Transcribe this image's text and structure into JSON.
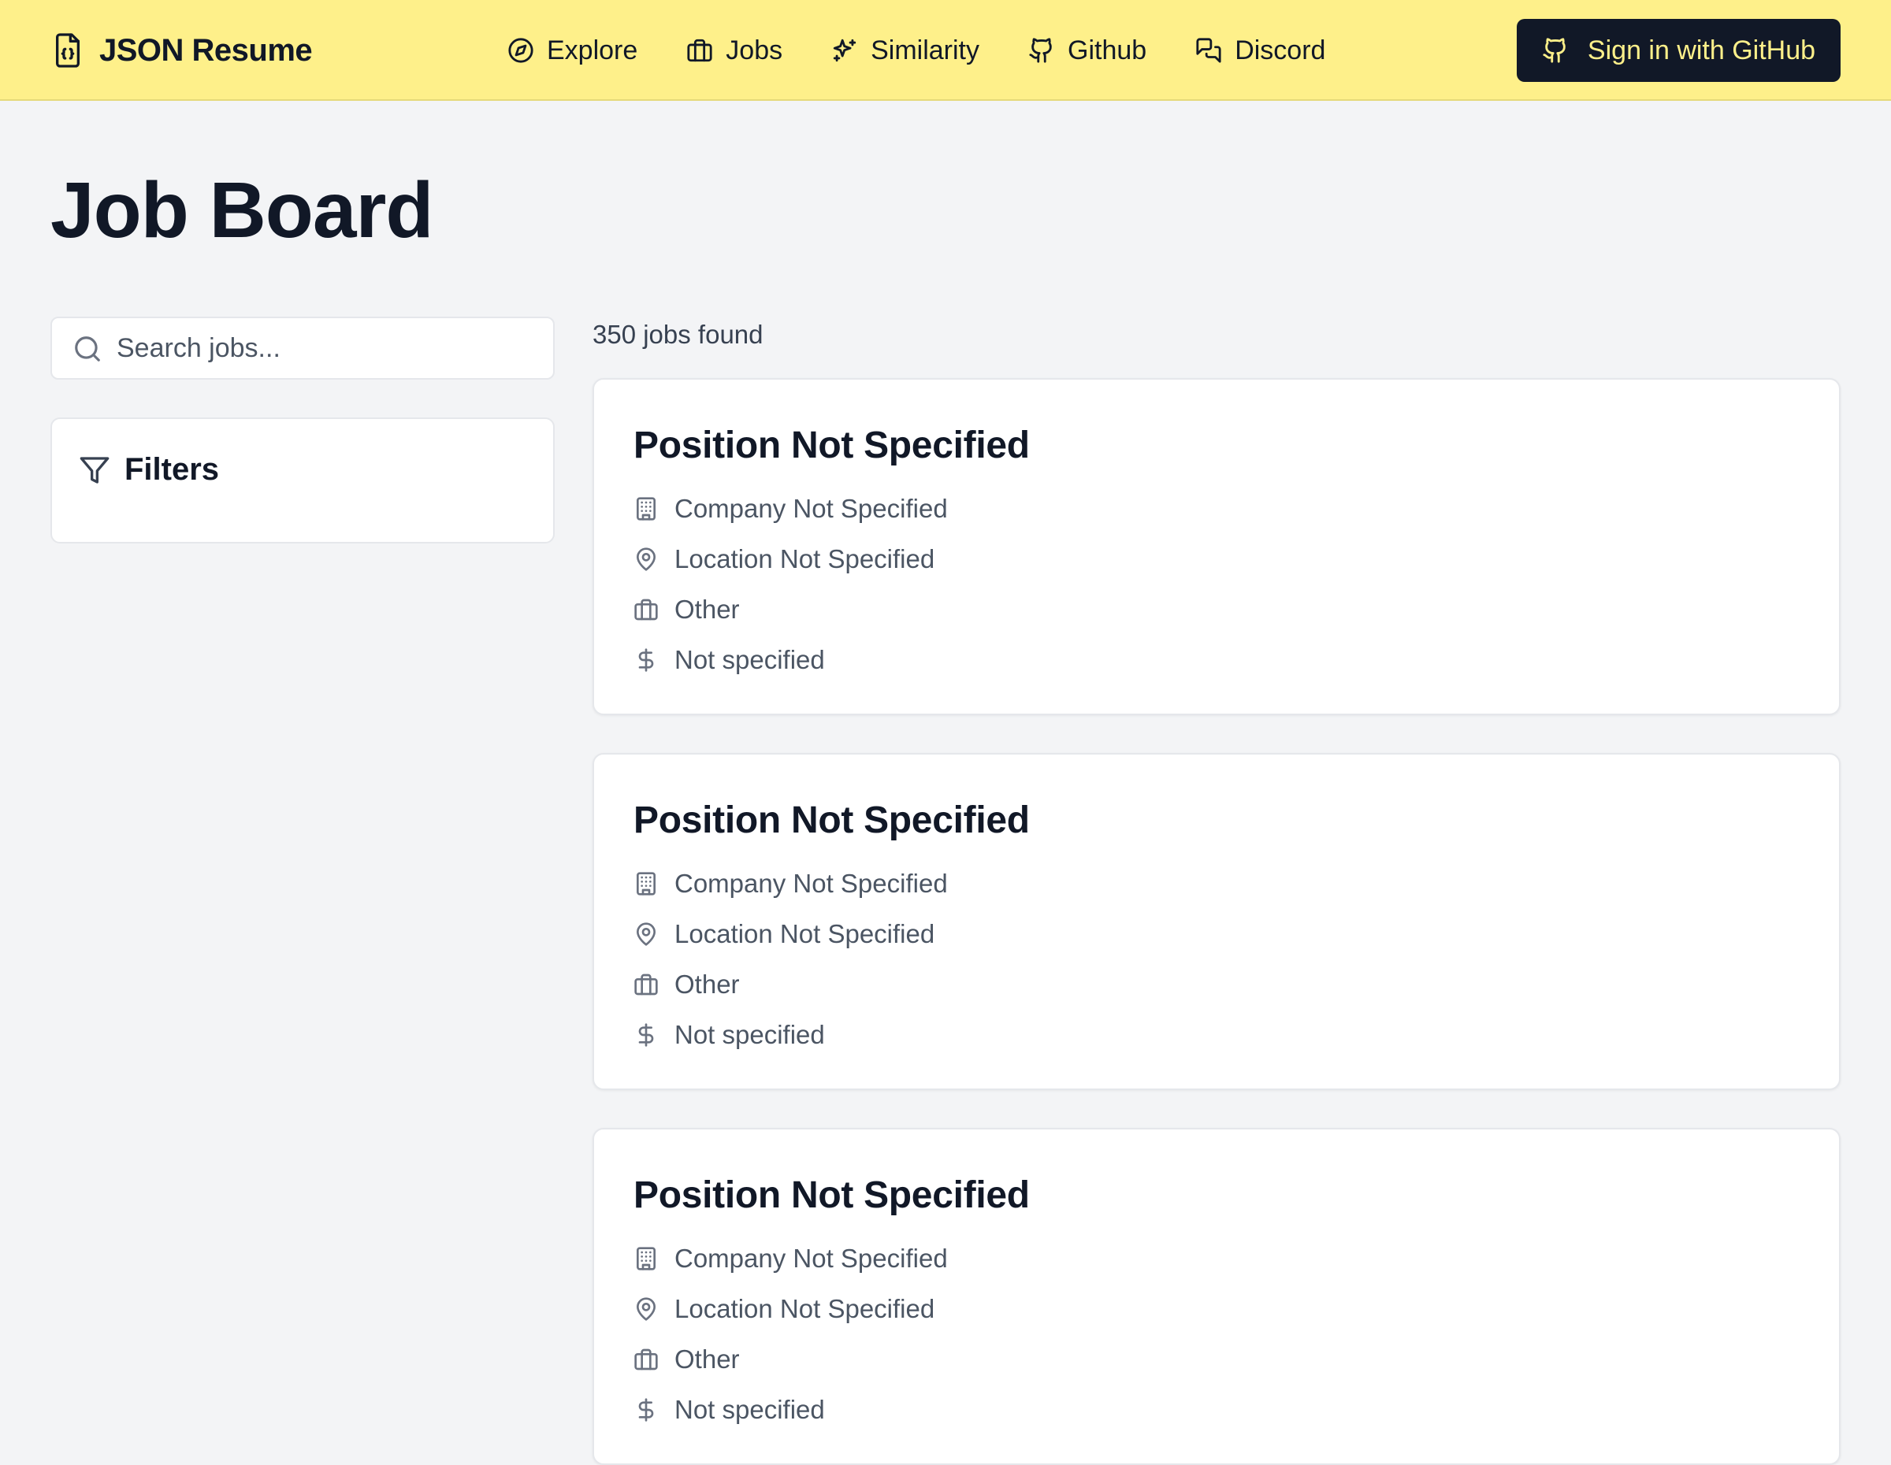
{
  "header": {
    "brand": "JSON Resume",
    "nav": [
      {
        "label": "Explore",
        "icon": "compass-icon"
      },
      {
        "label": "Jobs",
        "icon": "briefcase-icon"
      },
      {
        "label": "Similarity",
        "icon": "sparkles-icon"
      },
      {
        "label": "Github",
        "icon": "github-icon"
      },
      {
        "label": "Discord",
        "icon": "chat-icon"
      }
    ],
    "signin_label": "Sign in with GitHub"
  },
  "page": {
    "title": "Job Board"
  },
  "search": {
    "placeholder": "Search jobs...",
    "value": ""
  },
  "filters": {
    "title": "Filters"
  },
  "results": {
    "count_label": "350 jobs found",
    "jobs": [
      {
        "title": "Position Not Specified",
        "company": "Company Not Specified",
        "location": "Location Not Specified",
        "type": "Other",
        "salary": "Not specified"
      },
      {
        "title": "Position Not Specified",
        "company": "Company Not Specified",
        "location": "Location Not Specified",
        "type": "Other",
        "salary": "Not specified"
      },
      {
        "title": "Position Not Specified",
        "company": "Company Not Specified",
        "location": "Location Not Specified",
        "type": "Other",
        "salary": "Not specified"
      }
    ]
  },
  "colors": {
    "header_bg": "#fef08a",
    "button_bg": "#111827",
    "button_text": "#fef08a",
    "page_bg": "#f3f4f6"
  }
}
